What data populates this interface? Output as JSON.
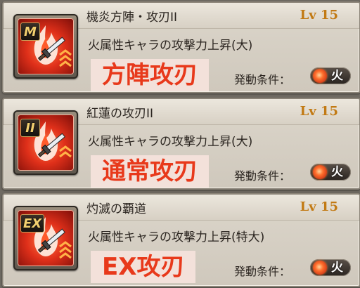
{
  "skills": [
    {
      "badge": "M",
      "name": "機炎方陣・攻刃II",
      "level": "Lv 15",
      "effect": "火属性キャラの攻撃力上昇(大)",
      "tag": "方陣攻刃",
      "condition_label": "発動条件：",
      "condition_element": "火",
      "icon": "fire-sword-icon"
    },
    {
      "badge": "II",
      "name": "紅蓮の攻刃II",
      "level": "Lv 15",
      "effect": "火属性キャラの攻撃力上昇(大)",
      "tag": "通常攻刃",
      "condition_label": "発動条件：",
      "condition_element": "火",
      "icon": "fire-sword-icon"
    },
    {
      "badge": "EX",
      "name": "灼滅の覇道",
      "level": "Lv 15",
      "effect": "火属性キャラの攻撃力上昇(特大)",
      "tag": "EX攻刃",
      "condition_label": "発動条件：",
      "condition_element": "火",
      "icon": "fire-sword-icon"
    }
  ],
  "colors": {
    "tag_text": "#e8391b",
    "tag_bg": "#f3e1da",
    "level_text": "#c27a14"
  }
}
